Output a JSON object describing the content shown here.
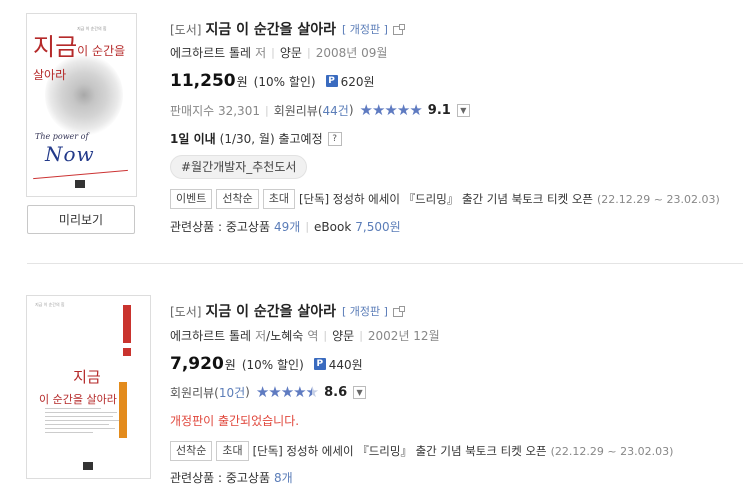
{
  "books": [
    {
      "category": "[도서]",
      "title": "지금 이 순간을 살아라",
      "edition": "[ 개정판 ]",
      "author": "에크하르트 톨레",
      "author_role": "저",
      "translator": "",
      "translator_role": "",
      "publisher": "양문",
      "date": "2008년 09월",
      "price": "11,250",
      "won": "원",
      "discount": "(10% 할인)",
      "point_badge": "P",
      "point": "620원",
      "sales_label": "판매지수 32,301",
      "review_label": "회원리뷰(",
      "review_count": "44건",
      "review_close": ")",
      "star_rating": 5,
      "rating": "9.1",
      "ship_bold": "1일 이내",
      "ship_normal": "(1/30, 월) 출고예정",
      "ship_help": "?",
      "hashtag": "#월간개발자_추천도서",
      "tags": [
        "이벤트",
        "선착순",
        "초대"
      ],
      "event_text": "[단독] 정성하 에세이 『드리밍』 출간 기념 북토크 티켓 오픈",
      "event_date": "(22.12.29 ~ 23.02.03)",
      "related_label": "관련상품 : 중고상품",
      "related_used": "49개",
      "related_ebook_label": "eBook",
      "related_ebook": "7,500원",
      "preview_label": "미리보기",
      "cover": {
        "title_big": "지금",
        "title_rest": "이 순간을 살아라",
        "sub": "지금 이 순간의 힘",
        "script": "The power of",
        "now": "Now"
      }
    },
    {
      "category": "[도서]",
      "title": "지금 이 순간을 살아라",
      "edition": "[ 개정판 ]",
      "author": "에크하르트 톨레",
      "author_role": "저",
      "translator": "/노혜숙",
      "translator_role": "역",
      "publisher": "양문",
      "date": "2002년 12월",
      "price": "7,920",
      "won": "원",
      "discount": "(10% 할인)",
      "point_badge": "P",
      "point": "440원",
      "review_label": "회원리뷰(",
      "review_count": "10건",
      "review_close": ")",
      "star_rating": 4.5,
      "rating": "8.6",
      "notice": "개정판이 출간되었습니다.",
      "tags": [
        "선착순",
        "초대"
      ],
      "event_text": "[단독] 정성하 에세이 『드리밍』 출간 기념 북토크 티켓 오픈",
      "event_date": "(22.12.29 ~ 23.02.03)",
      "related_label": "관련상품 : 중고상품",
      "related_used": "8개",
      "cover": {
        "title_big": "지금",
        "title_rest": "이 순간을 살아라",
        "sub": "지금 이 순간의 힘"
      }
    }
  ],
  "icons": {
    "star_full": "★",
    "dropdown": "⌄",
    "external": "external-link-icon"
  },
  "colors": {
    "link": "#5b7db8",
    "star": "#5f7bc1",
    "notice": "#e0483d",
    "point_badge": "#3a6bbf"
  }
}
